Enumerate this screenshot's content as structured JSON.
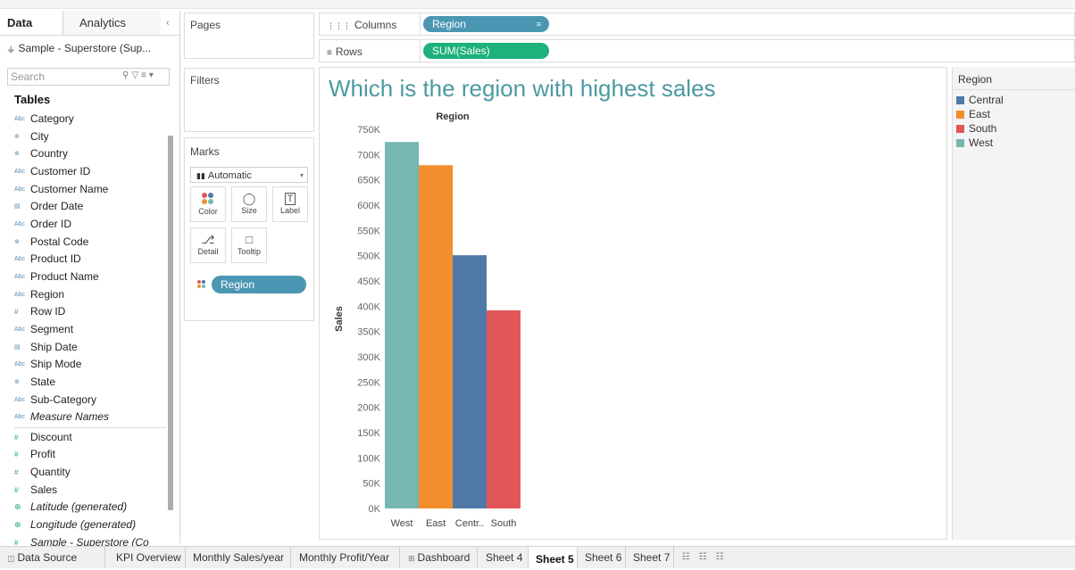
{
  "data_pane": {
    "tabs": {
      "data": "Data",
      "analytics": "Analytics"
    },
    "datasource": "Sample - Superstore (Sup...",
    "search_placeholder": "Search",
    "tables_title": "Tables",
    "fields": [
      {
        "name": "Category",
        "type": "Abc"
      },
      {
        "name": "City",
        "type": "geo"
      },
      {
        "name": "Country",
        "type": "geo"
      },
      {
        "name": "Customer ID",
        "type": "Abc"
      },
      {
        "name": "Customer Name",
        "type": "Abc"
      },
      {
        "name": "Order Date",
        "type": "date"
      },
      {
        "name": "Order ID",
        "type": "Abc"
      },
      {
        "name": "Postal Code",
        "type": "geo"
      },
      {
        "name": "Product ID",
        "type": "Abc"
      },
      {
        "name": "Product Name",
        "type": "Abc"
      },
      {
        "name": "Region",
        "type": "Abc"
      },
      {
        "name": "Row ID",
        "type": "num"
      },
      {
        "name": "Segment",
        "type": "Abc"
      },
      {
        "name": "Ship Date",
        "type": "date"
      },
      {
        "name": "Ship Mode",
        "type": "Abc"
      },
      {
        "name": "State",
        "type": "geo"
      },
      {
        "name": "Sub-Category",
        "type": "Abc"
      },
      {
        "name": "Measure Names",
        "type": "Abc",
        "italic": true
      }
    ],
    "measures": [
      {
        "name": "Discount",
        "type": "num"
      },
      {
        "name": "Profit",
        "type": "num"
      },
      {
        "name": "Quantity",
        "type": "num"
      },
      {
        "name": "Sales",
        "type": "num"
      },
      {
        "name": "Latitude (generated)",
        "type": "geo",
        "italic": true
      },
      {
        "name": "Longitude (generated)",
        "type": "geo",
        "italic": true
      },
      {
        "name": "Sample - Superstore (Co",
        "type": "num",
        "italic": true
      }
    ]
  },
  "cards": {
    "pages": "Pages",
    "filters": "Filters",
    "marks": "Marks",
    "mark_type": "Automatic",
    "mark_buttons": {
      "color": "Color",
      "size": "Size",
      "label": "Label",
      "detail": "Detail",
      "tooltip": "Tooltip"
    },
    "color_field": "Region"
  },
  "shelves": {
    "columns_label": "Columns",
    "columns_pill": "Region",
    "rows_label": "Rows",
    "rows_pill": "SUM(Sales)"
  },
  "view": {
    "title": "Which is the region with highest sales"
  },
  "legend": {
    "title": "Region",
    "items": [
      {
        "label": "Central",
        "color": "#4e79a7"
      },
      {
        "label": "East",
        "color": "#f28e2b"
      },
      {
        "label": "South",
        "color": "#e15759"
      },
      {
        "label": "West",
        "color": "#76b7b2"
      }
    ]
  },
  "chart_data": {
    "type": "bar",
    "title": "",
    "header": "Region",
    "xlabel": "",
    "ylabel": "Sales",
    "categories": [
      "West",
      "East",
      "Centr..",
      "South"
    ],
    "full_categories": [
      "West",
      "East",
      "Central",
      "South"
    ],
    "values": [
      725000,
      679000,
      501000,
      392000
    ],
    "colors": [
      "#76b7b2",
      "#f28e2b",
      "#4e79a7",
      "#e15759"
    ],
    "ylim": [
      0,
      750000
    ],
    "yticks": [
      0,
      50000,
      100000,
      150000,
      200000,
      250000,
      300000,
      350000,
      400000,
      450000,
      500000,
      550000,
      600000,
      650000,
      700000,
      750000
    ],
    "ytick_labels": [
      "0K",
      "50K",
      "100K",
      "150K",
      "200K",
      "250K",
      "300K",
      "350K",
      "400K",
      "450K",
      "500K",
      "550K",
      "600K",
      "650K",
      "700K",
      "750K"
    ],
    "grid": false,
    "legend": "right"
  },
  "sheet_tabs": {
    "data_source": "Data Source",
    "tabs": [
      "KPI Overview",
      "Monthly Sales/year",
      "Monthly Profit/Year",
      "Dashboard",
      "Sheet 4",
      "Sheet 5",
      "Sheet 6",
      "Sheet 7"
    ],
    "active": "Sheet 5"
  }
}
